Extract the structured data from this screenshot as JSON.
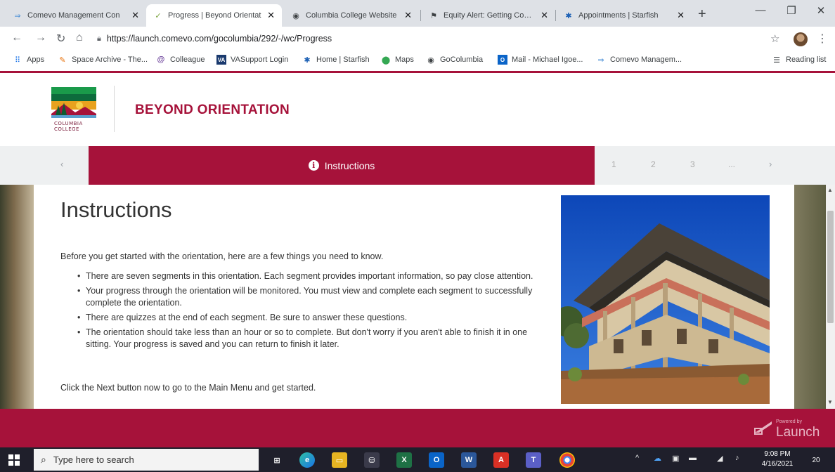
{
  "browser": {
    "tabs": [
      {
        "title": "Comevo Management Con",
        "favicon": "comevo-icon"
      },
      {
        "title": "Progress | Beyond Orientat",
        "favicon": "launch-icon"
      },
      {
        "title": "Columbia College Website",
        "favicon": "globe-icon"
      },
      {
        "title": "Equity Alert: Getting Comm",
        "favicon": "alert-icon"
      },
      {
        "title": "Appointments | Starfish",
        "favicon": "starfish-icon"
      }
    ],
    "active_tab": 1,
    "url": "https://launch.comevo.com/gocolumbia/292/-/wc/Progress",
    "bookmarks": [
      {
        "label": "Apps"
      },
      {
        "label": "Space Archive - The..."
      },
      {
        "label": "Colleague"
      },
      {
        "label": "VASupport Login"
      },
      {
        "label": "Home | Starfish"
      },
      {
        "label": "Maps"
      },
      {
        "label": "GoColumbia"
      },
      {
        "label": "Mail - Michael Igoe..."
      },
      {
        "label": "Comevo Managem..."
      }
    ],
    "reading_list": "Reading list"
  },
  "header": {
    "logo_text": "COLUMBIA COLLEGE",
    "title": "BEYOND ORIENTATION"
  },
  "nav": {
    "active_label": "Instructions",
    "segments": [
      "1",
      "2",
      "3",
      "..."
    ]
  },
  "main": {
    "heading": "Instructions",
    "intro": "Before you get started with the orientation, here are a few things you need to know.",
    "bullets": [
      "There are seven segments in this orientation. Each segment provides important information, so pay close attention.",
      "Your progress through the orientation will be monitored. You must view and complete each segment to successfully complete the orientation.",
      "There are quizzes at the end of each segment. Be sure to answer these questions.",
      "The orientation should take less than an hour or so to complete. But don't worry if you aren't able to finish it in one sitting. Your progress is saved and you can return to finish it later."
    ],
    "cta": "Click the Next button now to go to the Main Menu and get started."
  },
  "footer": {
    "powered_by": "Powered by",
    "brand": "Launch"
  },
  "taskbar": {
    "search_placeholder": "Type here to search",
    "time": "9:08 PM",
    "date": "4/16/2021",
    "notifications": "20"
  },
  "colors": {
    "brand": "#a6123a",
    "nav_bg": "#eef0f1"
  }
}
